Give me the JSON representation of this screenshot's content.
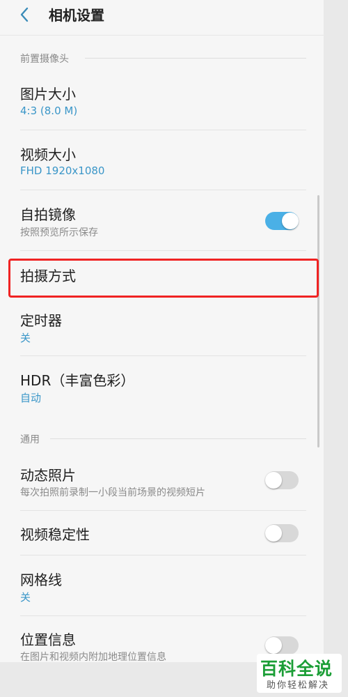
{
  "header": {
    "title": "相机设置"
  },
  "front_section": {
    "label": "前置摄像头",
    "picture_size": {
      "title": "图片大小",
      "value": "4:3 (8.0 M)"
    },
    "video_size": {
      "title": "视频大小",
      "value": "FHD 1920x1080"
    },
    "selfie_mirror": {
      "title": "自拍镜像",
      "desc": "按照预览所示保存",
      "enabled": true
    },
    "shooting_method": {
      "title": "拍摄方式"
    },
    "timer": {
      "title": "定时器",
      "value": "关"
    },
    "hdr": {
      "title": "HDR（丰富色彩）",
      "value": "自动"
    }
  },
  "general_section": {
    "label": "通用",
    "motion_photo": {
      "title": "动态照片",
      "desc": "每次拍照前录制一小段当前场景的视频短片",
      "enabled": false
    },
    "video_stabilization": {
      "title": "视频稳定性",
      "enabled": false
    },
    "grid_lines": {
      "title": "网格线",
      "value": "关"
    },
    "location_tags": {
      "title": "位置信息",
      "desc": "在图片和视频内附加地理位置信息",
      "enabled": false
    }
  },
  "watermark": {
    "logo": "百科全说",
    "tagline": "助你轻松解决"
  },
  "colors": {
    "accent": "#3a96c8",
    "toggle_on": "#4ab0e6",
    "highlight": "#f02323",
    "watermark_green": "#1b9e36"
  }
}
